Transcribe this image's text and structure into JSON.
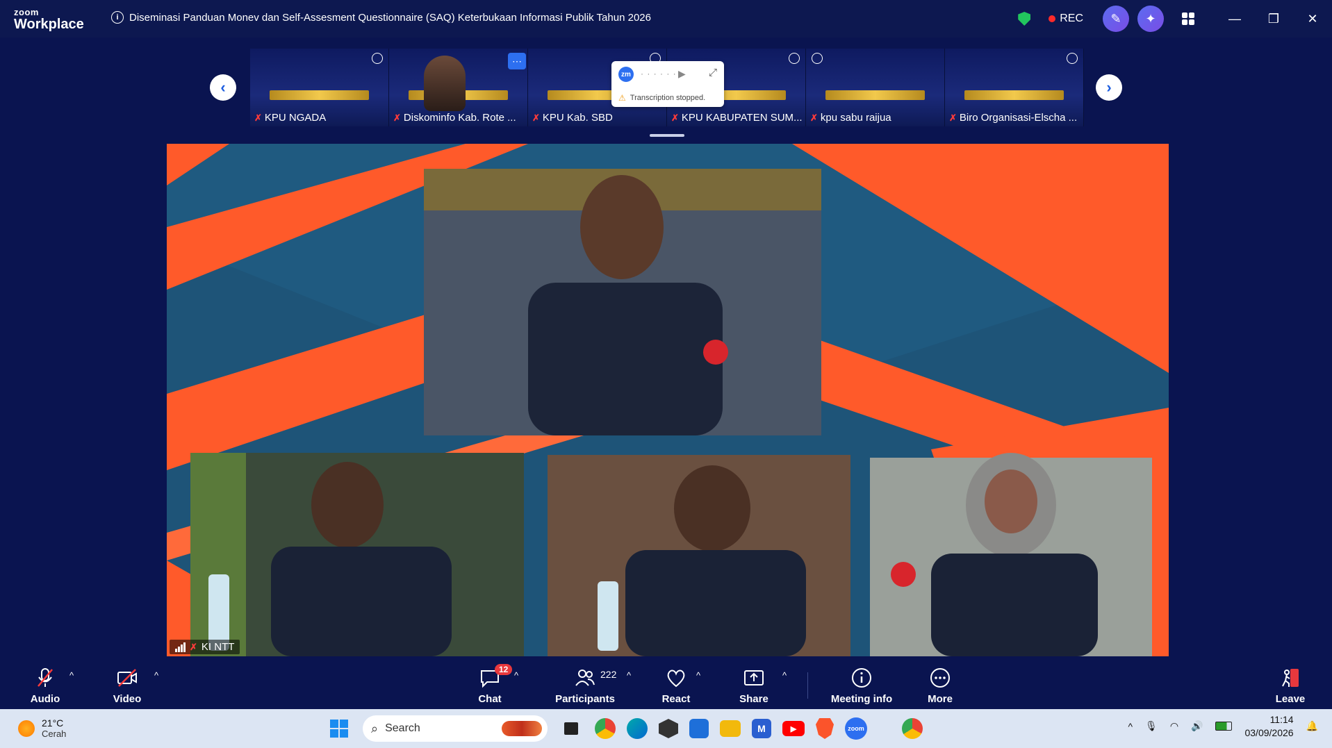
{
  "app": {
    "logo_line1": "zoom",
    "logo_line2": "Workplace"
  },
  "meeting_title": "Diseminasi Panduan Monev dan Self-Assesment Questionnaire (SAQ) Keterbukaan Informasi Publik Tahun 2026",
  "recording_label": "REC",
  "thumbnails": [
    {
      "name": "KPU NGADA"
    },
    {
      "name": "Diskominfo Kab. Rote ..."
    },
    {
      "name": "KPU Kab. SBD"
    },
    {
      "name": "KPU KABUPATEN SUM..."
    },
    {
      "name": "kpu sabu raijua"
    },
    {
      "name": "Biro Organisasi-Elscha ..."
    }
  ],
  "transcription": {
    "logo": "zm",
    "status": "Transcription stopped."
  },
  "main_video": {
    "participant_name": "KI NTT"
  },
  "toolbar": {
    "audio": "Audio",
    "video": "Video",
    "chat": "Chat",
    "chat_badge": "12",
    "participants": "Participants",
    "participants_count": "222",
    "react": "React",
    "share": "Share",
    "meeting_info": "Meeting info",
    "more": "More",
    "leave": "Leave"
  },
  "taskbar": {
    "weather_temp": "21°C",
    "weather_desc": "Cerah",
    "search_placeholder": "Search",
    "time": "11:14",
    "date": "03/09/2026"
  },
  "colors": {
    "accent": "#2d6ff0",
    "rec": "#ff2a2a",
    "leave": "#e8383d",
    "bg": "#0a1450"
  }
}
